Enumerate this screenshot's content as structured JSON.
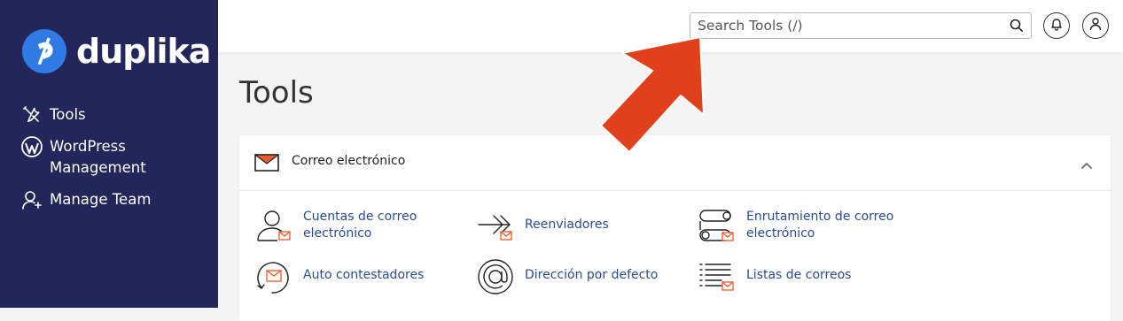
{
  "brand": {
    "name": "duplika",
    "accent": "#2f7ae5",
    "sidebar_bg": "#23265a"
  },
  "sidebar": {
    "items": [
      {
        "label": "Tools",
        "icon": "tools-icon"
      },
      {
        "label": "WordPress Management",
        "label_line1": "WordPress",
        "label_line2": "Management",
        "icon": "wordpress-icon"
      },
      {
        "label": "Manage Team",
        "icon": "manage-team-icon"
      }
    ]
  },
  "header": {
    "search": {
      "placeholder": "Search Tools (/)",
      "icon": "search-icon"
    },
    "notifications_icon": "bell-icon",
    "user_icon": "user-icon"
  },
  "main": {
    "title": "Tools",
    "panel": {
      "title": "Correo electrónico",
      "icon": "envelope-icon",
      "collapse_icon": "chevron-up-icon",
      "tools": [
        {
          "label_line1": "Cuentas de correo",
          "label_line2": "electrónico",
          "icon": "email-accounts-icon"
        },
        {
          "label_line1": "Reenviadores",
          "label_line2": "",
          "icon": "forwarders-icon"
        },
        {
          "label_line1": "Enrutamiento de correo",
          "label_line2": "electrónico",
          "icon": "email-routing-icon"
        },
        {
          "label_line1": "Auto contestadores",
          "label_line2": "",
          "icon": "autoresponders-icon"
        },
        {
          "label_line1": "Dirección por defecto",
          "label_line2": "",
          "icon": "default-address-icon"
        },
        {
          "label_line1": "Listas de correos",
          "label_line2": "",
          "icon": "mailing-lists-icon"
        }
      ]
    }
  },
  "annotation": {
    "arrow_color": "#e0401c"
  }
}
